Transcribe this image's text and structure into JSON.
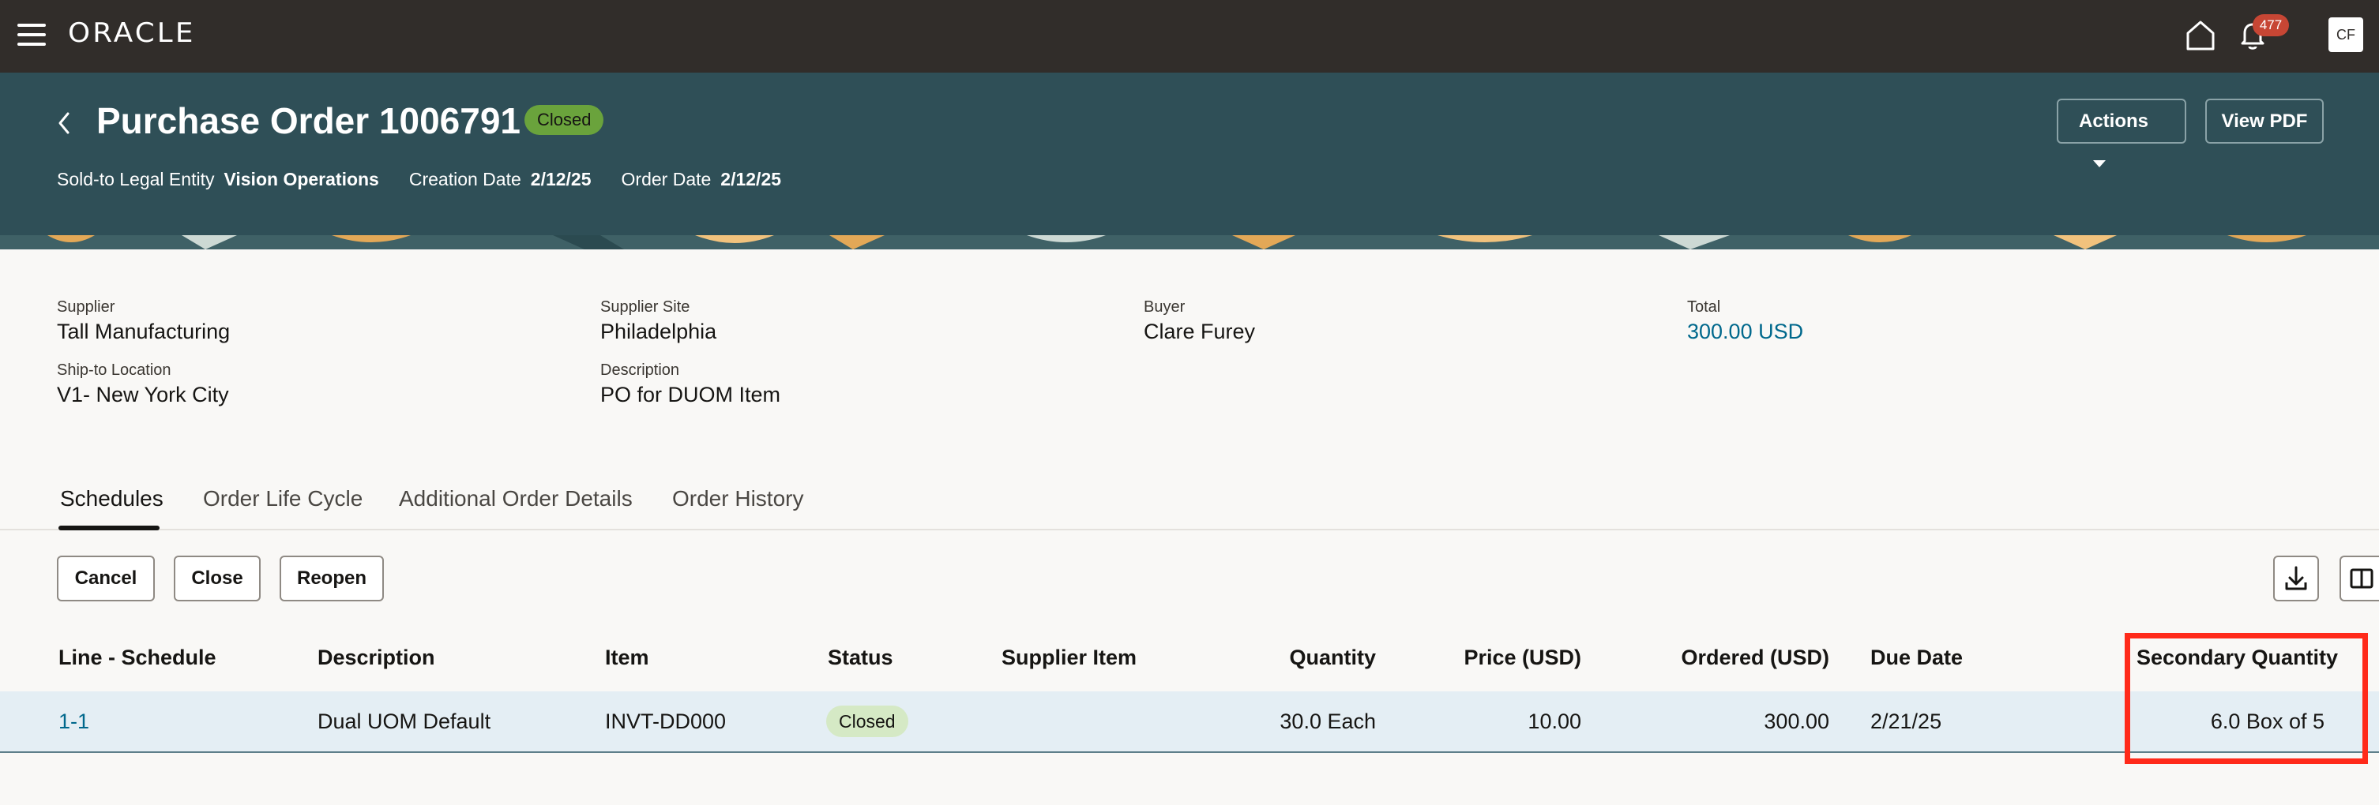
{
  "topbar": {
    "logo": "ORACLE",
    "notifications_count": "477",
    "avatar_initials": "CF"
  },
  "header": {
    "title": "Purchase Order 1006791",
    "status": "Closed",
    "sold_to_label": "Sold-to Legal Entity",
    "sold_to_value": "Vision Operations",
    "creation_date_label": "Creation Date",
    "creation_date_value": "2/12/25",
    "order_date_label": "Order Date",
    "order_date_value": "2/12/25",
    "actions_label": "Actions",
    "view_pdf_label": "View PDF"
  },
  "summary": {
    "supplier_label": "Supplier",
    "supplier_value": "Tall Manufacturing",
    "ship_to_label": "Ship-to Location",
    "ship_to_value": "V1- New York City",
    "supplier_site_label": "Supplier Site",
    "supplier_site_value": "Philadelphia",
    "description_label": "Description",
    "description_value": "PO for DUOM Item",
    "buyer_label": "Buyer",
    "buyer_value": "Clare Furey",
    "total_label": "Total",
    "total_value": "300.00 USD"
  },
  "tabs": [
    "Schedules",
    "Order Life Cycle",
    "Additional Order Details",
    "Order History"
  ],
  "toolbar": {
    "cancel_label": "Cancel",
    "close_label": "Close",
    "reopen_label": "Reopen"
  },
  "table": {
    "columns": [
      "Line - Schedule",
      "Description",
      "Item",
      "Status",
      "Supplier Item",
      "Quantity",
      "Price (USD)",
      "Ordered (USD)",
      "Due Date",
      "Secondary Quantity"
    ],
    "rows": [
      {
        "line_schedule": "1-1",
        "description": "Dual UOM Default",
        "item": "INVT-DD000",
        "status": "Closed",
        "supplier_item": "",
        "quantity": "30.0 Each",
        "price": "10.00",
        "ordered": "300.00",
        "due_date": "2/21/25",
        "secondary_quantity": "6.0 Box of 5"
      }
    ]
  },
  "colors": {
    "topbar": "#312d2a",
    "header": "#2f4f57",
    "link": "#00688c",
    "status_green": "#6aa33c",
    "highlight": "#ff2a1a"
  }
}
